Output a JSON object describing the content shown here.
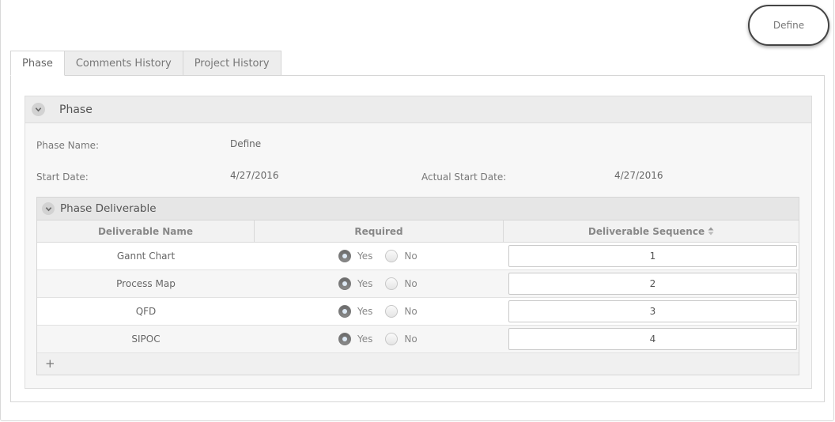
{
  "top_action": {
    "label": "Define"
  },
  "tabs": [
    {
      "label": "Phase",
      "active": true
    },
    {
      "label": "Comments History",
      "active": false
    },
    {
      "label": "Project History",
      "active": false
    }
  ],
  "phase": {
    "title": "Phase",
    "fields": {
      "phase_name_label": "Phase Name:",
      "phase_name_value": "Define",
      "start_date_label": "Start Date:",
      "start_date_value": "4/27/2016",
      "actual_start_label": "Actual Start Date:",
      "actual_start_value": "4/27/2016"
    }
  },
  "deliverables": {
    "title": "Phase Deliverable",
    "columns": [
      "Deliverable Name",
      "Required",
      "Deliverable Sequence"
    ],
    "yes_label": "Yes",
    "no_label": "No",
    "rows": [
      {
        "name": "Gannt Chart",
        "required": "Yes",
        "sequence": "1"
      },
      {
        "name": "Process Map",
        "required": "Yes",
        "sequence": "2"
      },
      {
        "name": "QFD",
        "required": "Yes",
        "sequence": "3"
      },
      {
        "name": "SIPOC",
        "required": "Yes",
        "sequence": "4"
      }
    ],
    "add_label": "+"
  },
  "icons": {
    "collapse": "chevron-down-icon",
    "sort": "sort-icon"
  }
}
